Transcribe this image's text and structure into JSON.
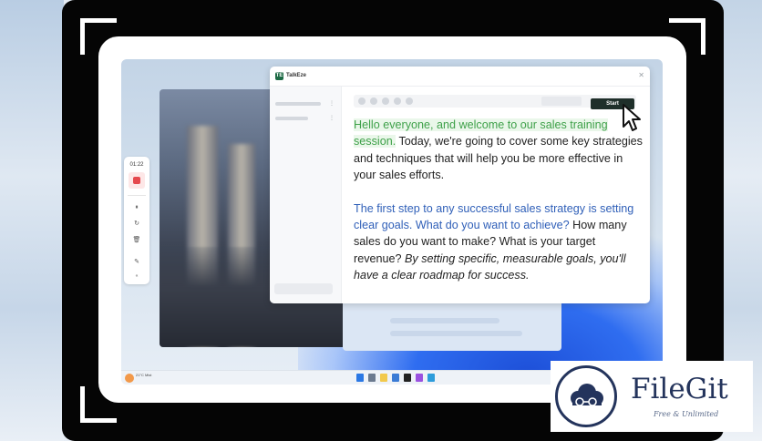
{
  "app": {
    "name": "TalkEze",
    "logo_text": "TE",
    "close_glyph": "✕",
    "start_label": "Start"
  },
  "recorder": {
    "time": "01:22",
    "tools": [
      "⏸",
      "↻",
      "🗑",
      "✎",
      "«"
    ]
  },
  "script": {
    "para1": {
      "highlighted": "Hello everyone, and welcome to our sales training session.",
      "rest": " Today, we're going to cover some key strategies and techniques that will help you be more effective in your sales efforts."
    },
    "para2": {
      "highlighted": "The first step to any successful sales strategy is setting clear goals. What do you want to achieve?",
      "plain": " How many sales do you want to make? What is your target revenue? ",
      "italic": "By setting specific, measurable goals, you'll have a clear roadmap for success."
    }
  },
  "sidebar": {
    "dots": "⋮"
  },
  "taskbar": {
    "weather_text": "21°C Mist"
  },
  "watermark": {
    "title": "FileGit",
    "subtitle": "Free & Unlimited"
  },
  "colors": {
    "highlight_green": "#3fa14a",
    "highlight_blue": "#2f5fb8",
    "start_button": "#1f2f2a",
    "record_red": "#e5484d"
  }
}
